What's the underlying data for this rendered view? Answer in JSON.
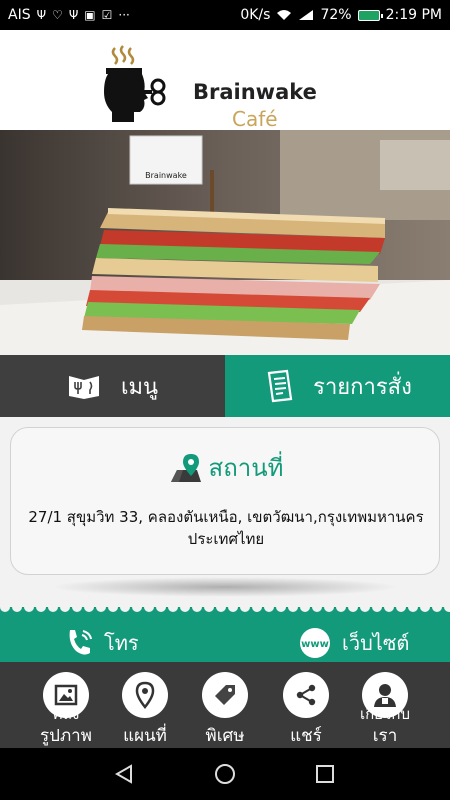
{
  "status_bar": {
    "carrier": "AIS",
    "icons": [
      "usb-icon",
      "heart-pulse-icon",
      "usb-icon",
      "image-icon",
      "check-icon"
    ],
    "more": "···",
    "net_speed": "0K/s",
    "battery": "72%",
    "time": "2:19 PM"
  },
  "brand": {
    "name": "Brainwake",
    "subtitle": "Café"
  },
  "tabs": {
    "menu_label": "เมนู",
    "order_label": "รายการสั่ง"
  },
  "location": {
    "title": "สถานที่",
    "address_line1": "27/1 สุขุมวิท 33, คลองตันเหนือ, เขตวัฒนา,กรุงเทพมหานคร",
    "address_line2": "ประเทศไทย"
  },
  "contact": {
    "call_label": "โทร",
    "website_label": "เว็บไซต์"
  },
  "bottom_nav": {
    "photos_over": "คลัง",
    "photos_label": "รูปภาพ",
    "map_label": "แผนที่",
    "special_label": "พิเศษ",
    "share_label": "แชร์",
    "about_over": "เกี่ยวกับ",
    "about_label": "เรา"
  },
  "colors": {
    "accent": "#129a7a",
    "tab_dark": "#3f3f3f",
    "nav_dark": "#3a3a3a",
    "brand_gold": "#c8a55a"
  }
}
